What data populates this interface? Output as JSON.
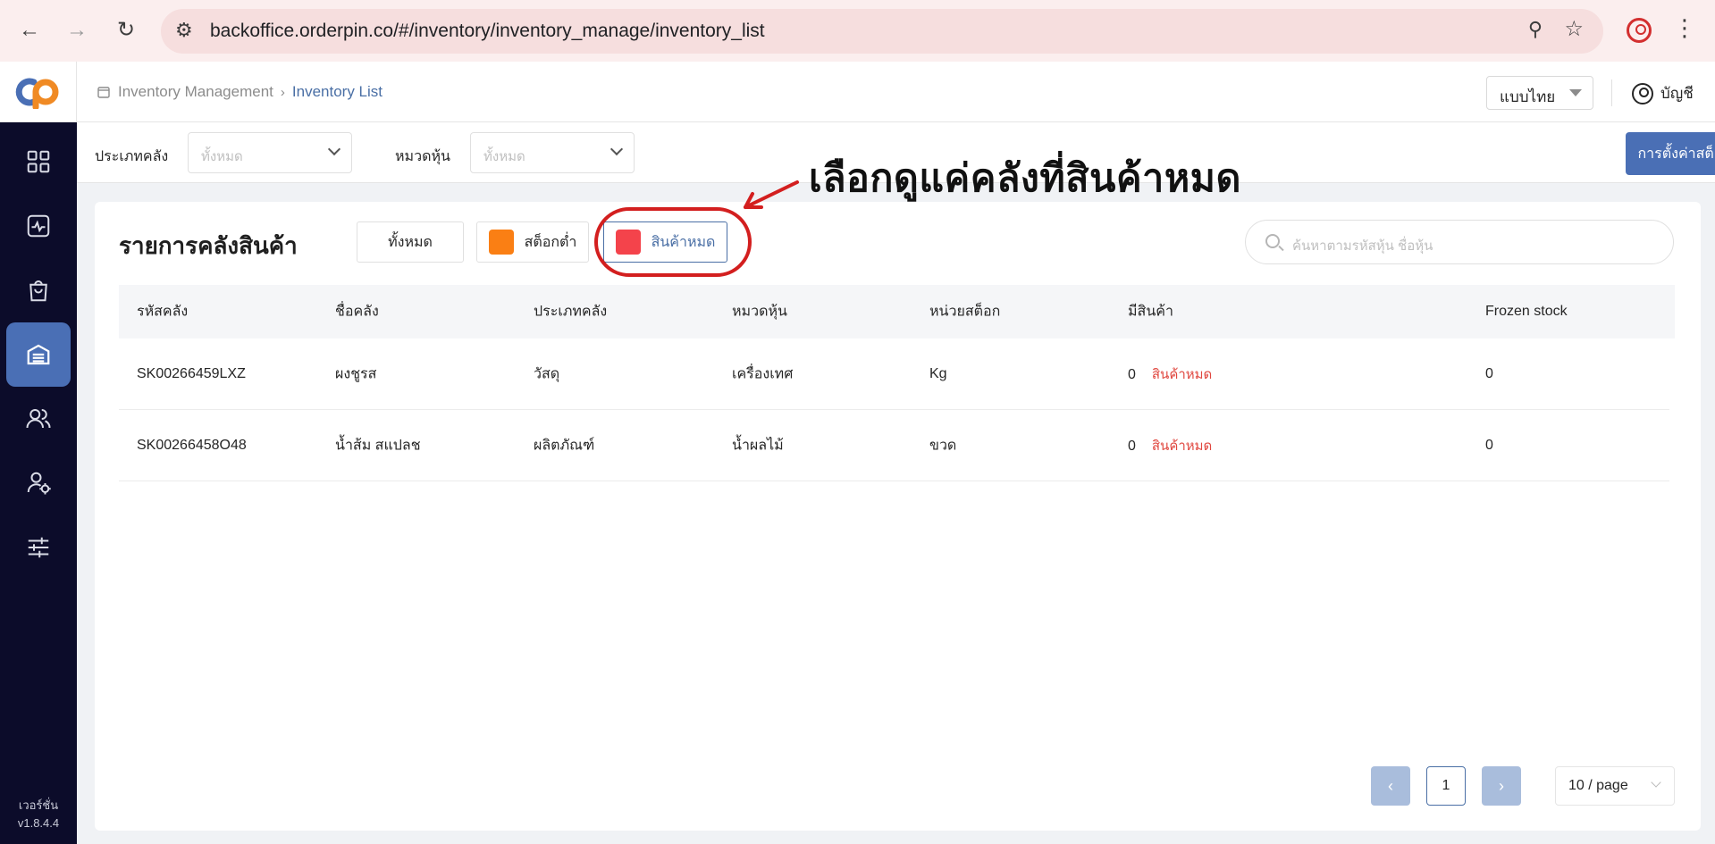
{
  "browser": {
    "url": "backoffice.orderpin.co/#/inventory/inventory_manage/inventory_list"
  },
  "sidebar": {
    "logo": "logo",
    "items": [
      {
        "icon": "dashboard-grid-icon",
        "active": false
      },
      {
        "icon": "activity-icon",
        "active": false
      },
      {
        "icon": "shopping-bag-icon",
        "active": false
      },
      {
        "icon": "warehouse-icon",
        "active": true
      },
      {
        "icon": "users-icon",
        "active": false
      },
      {
        "icon": "user-settings-icon",
        "active": false
      },
      {
        "icon": "sliders-icon",
        "active": false
      }
    ],
    "version_label": "เวอร์ชั่น",
    "version": "v1.8.4.4"
  },
  "header": {
    "breadcrumb_root": "Inventory Management",
    "breadcrumb_current": "Inventory List",
    "language": "แบบไทย",
    "account": "บัญชี"
  },
  "filters": {
    "warehouse_type_label": "ประเภทคลัง",
    "warehouse_type_value": "ทั้งหมด",
    "category_label": "หมวดหุ้น",
    "category_value": "ทั้งหมด",
    "settings_button": "การตั้งค่าสต็อกเตือน"
  },
  "main": {
    "title": "รายการคลังสินค้า",
    "tabs": [
      {
        "label": "ทั้งหมด",
        "color": null,
        "selected": false
      },
      {
        "label": "สต็อกต่ำ",
        "color": "#fa7f14",
        "selected": false
      },
      {
        "label": "สินค้าหมด",
        "color": "#f4434b",
        "selected": true
      }
    ],
    "search_placeholder": "ค้นหาตามรหัสหุ้น ชื่อหุ้น",
    "columns": [
      "รหัสคลัง",
      "ชื่อคลัง",
      "ประเภทคลัง",
      "หมวดหุ้น",
      "หน่วยสต็อก",
      "มีสินค้า",
      "Frozen stock"
    ],
    "rows": [
      {
        "code": "SK00266459LXZ",
        "name": "ผงชูรส",
        "type": "วัสดุ",
        "category": "เครื่องเทศ",
        "unit": "Kg",
        "qty": "0",
        "status": "สินค้าหมด",
        "frozen": "0"
      },
      {
        "code": "SK00266458O48",
        "name": "น้ำส้ม สแปลช",
        "type": "ผลิตภัณฑ์",
        "category": "น้ำผลไม้",
        "unit": "ขวด",
        "qty": "0",
        "status": "สินค้าหมด",
        "frozen": "0"
      }
    ],
    "pagination": {
      "prev": "‹",
      "page": "1",
      "next": "›",
      "page_size": "10 / page"
    }
  },
  "annotation": {
    "text": "เลือกดูแค่คลังที่สินค้าหมด",
    "color": "#d31f1f"
  },
  "colors": {
    "sidebar_bg": "#0c0c2a",
    "accent": "#4a6fb5",
    "out_of_stock": "#e0473f"
  }
}
